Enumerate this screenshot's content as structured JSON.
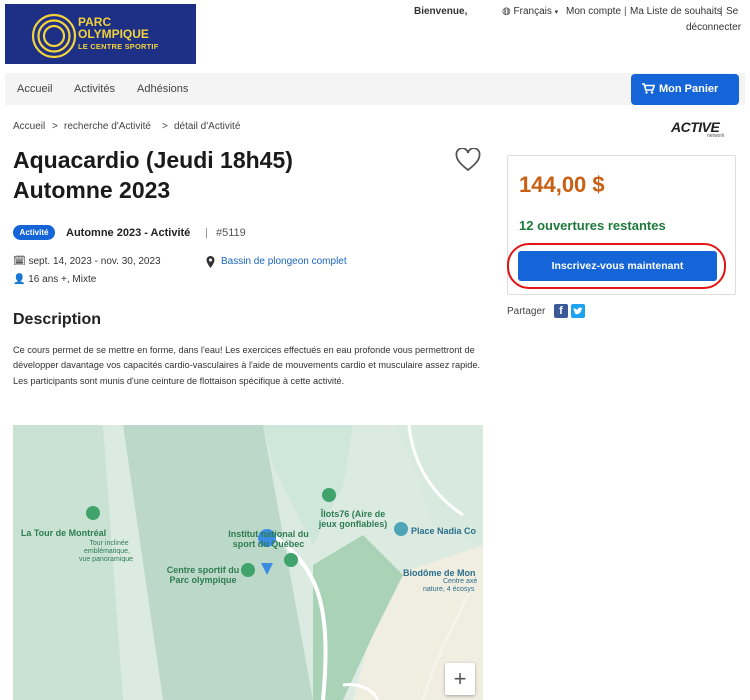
{
  "header": {
    "logo_line1": "PARC",
    "logo_line2": "OLYMPIQUE",
    "logo_line3": "LE CENTRE SPORTIF",
    "welcome": "Bienvenue,",
    "language": "Français",
    "account": "Mon compte",
    "wishlist": "Ma Liste de souhaits",
    "logout_1": "Se",
    "logout_2": "déconnecter"
  },
  "nav": {
    "items": [
      "Accueil",
      "Activités",
      "Adhésions"
    ],
    "cart_label": "Mon Panier"
  },
  "breadcrumb": [
    "Accueil",
    "recherche d'Activité",
    "détail d'Activité"
  ],
  "brand": {
    "active": "ACTIVE",
    "network": "network"
  },
  "activity": {
    "title_line1": "Aquacardio (Jeudi 18h45)",
    "title_line2": "Automne 2023",
    "badge": "Activité",
    "season": "Automne 2023 - Activité",
    "number": "#5119",
    "dates": "sept. 14, 2023 - nov. 30, 2023",
    "location": "Bassin de plongeon complet",
    "audience": "16 ans +, Mixte"
  },
  "description": {
    "heading": "Description",
    "text": "Ce cours permet de se mettre en forme, dans l'eau! Les exercices effectués en eau profonde vous permettront de développer davantage vos capacités cardio-vasculaires à l'aide de mouvements cardio et musculaire assez rapide. Les participants sont munis d'une ceinture de flottaison spécifique à cette activité."
  },
  "map": {
    "labels": {
      "tour": "La Tour de Montréal",
      "tour_sub1": "Tour inclinée",
      "tour_sub2": "emblématique,",
      "tour_sub3": "vue panoramique",
      "insq1": "Institut national du",
      "insq2": "sport du Québec",
      "ilots1": "Îlots76 (Aire de",
      "ilots2": "jeux gonflables)",
      "centre1": "Centre sportif du",
      "centre2": "Parc olympique",
      "nadia": "Place Nadia Co",
      "biodome": "Biodôme de Mon",
      "bio_sub1": "Centre axé",
      "bio_sub2": "nature, 4 écosys"
    },
    "zoom_in": "+"
  },
  "sidebar": {
    "price": "144,00 $",
    "openings": "12 ouvertures restantes",
    "signup": "Inscrivez-vous maintenant",
    "share": "Partager"
  },
  "colors": {
    "primary": "#1565d8",
    "price": "#c85f12",
    "openings": "#1d7a3a",
    "highlight": "#e01515"
  }
}
